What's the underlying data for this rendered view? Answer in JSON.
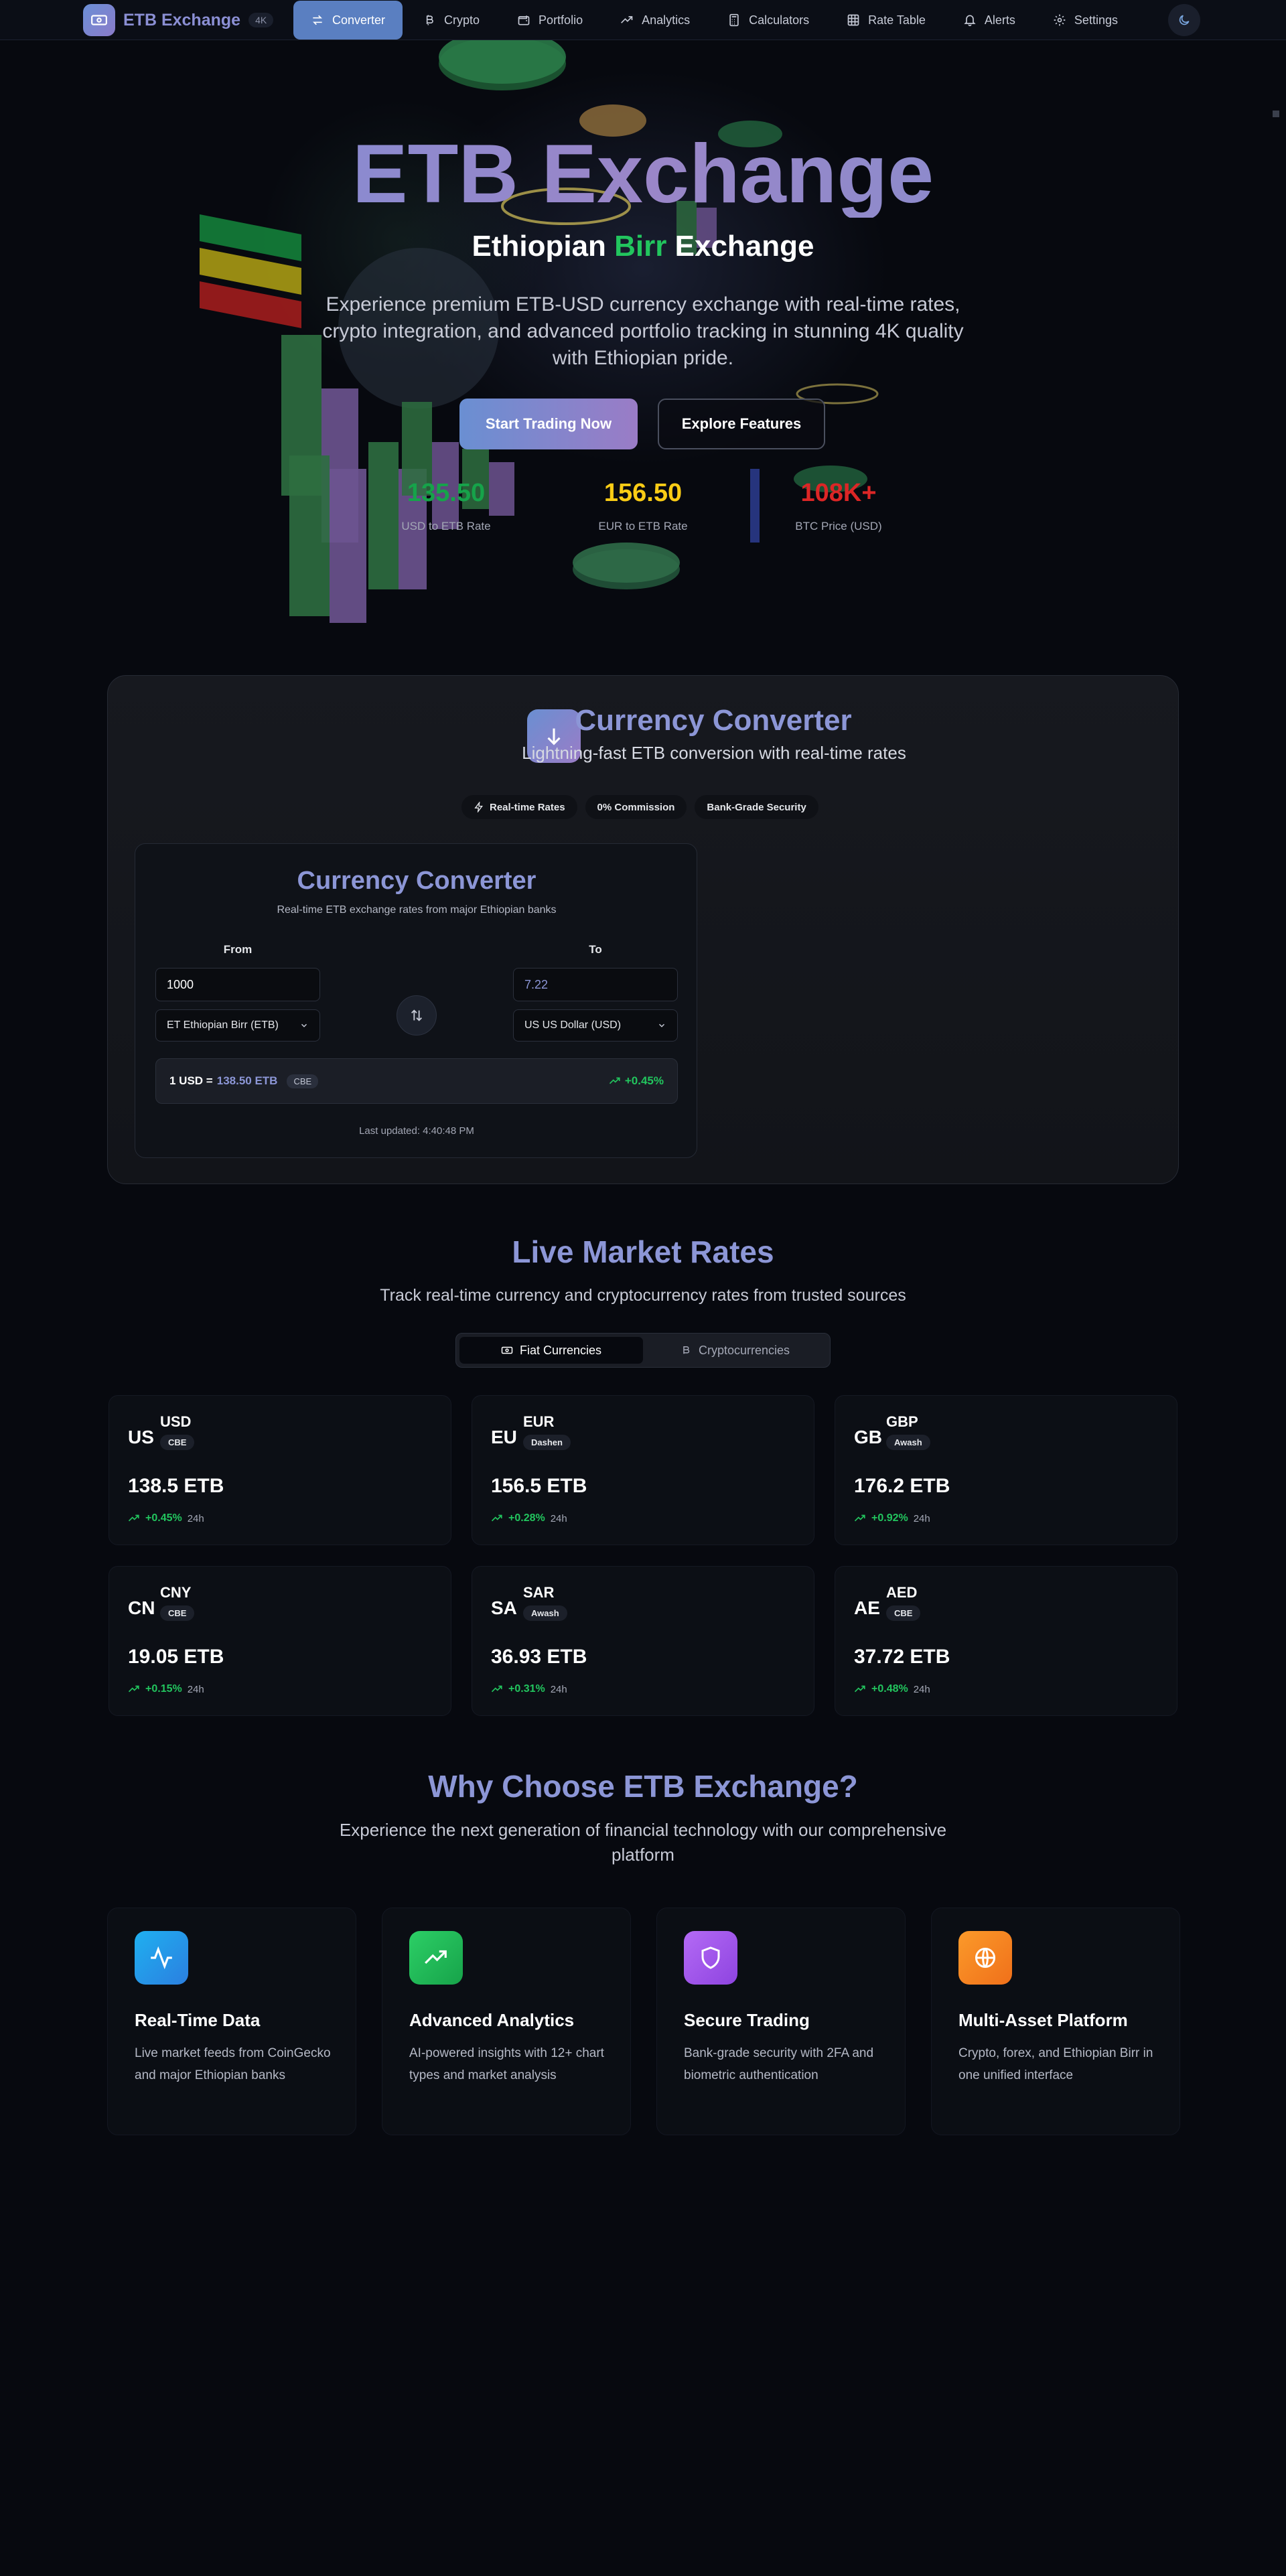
{
  "nav": {
    "brand": "ETB Exchange",
    "badge": "4K",
    "items": [
      {
        "label": "Converter",
        "icon": "arrows-swap-icon",
        "active": true
      },
      {
        "label": "Crypto",
        "icon": "bitcoin-icon",
        "active": false
      },
      {
        "label": "Portfolio",
        "icon": "wallet-icon",
        "active": false
      },
      {
        "label": "Analytics",
        "icon": "trend-up-icon",
        "active": false
      },
      {
        "label": "Calculators",
        "icon": "calculator-icon",
        "active": false
      },
      {
        "label": "Rate Table",
        "icon": "table-icon",
        "active": false
      },
      {
        "label": "Alerts",
        "icon": "bell-icon",
        "active": false
      },
      {
        "label": "Settings",
        "icon": "gear-icon",
        "active": false
      }
    ]
  },
  "hero": {
    "title": "ETB Exchange",
    "subtitle_pre": "Ethiopian ",
    "subtitle_birr": "Birr",
    "subtitle_post": " Exchange",
    "description": "Experience premium ETB-USD currency exchange with real-time rates, crypto integration, and advanced portfolio tracking in stunning 4K quality with Ethiopian pride.",
    "primary_button": "Start Trading Now",
    "secondary_button": "Explore Features",
    "stats": [
      {
        "value": "135.50",
        "label": "USD to ETB Rate",
        "color": "#16a34a"
      },
      {
        "value": "156.50",
        "label": "EUR to ETB Rate",
        "color": "#facc15"
      },
      {
        "value": "108K+",
        "label": "BTC Price (USD)",
        "color": "#dc2626"
      }
    ]
  },
  "converter_section": {
    "title": "Currency Converter",
    "subtitle": "Lightning-fast ETB conversion with real-time rates",
    "chips": [
      "Real-time Rates",
      "0% Commission",
      "Bank-Grade Security"
    ],
    "widget": {
      "title": "Currency Converter",
      "subtitle": "Real-time ETB exchange rates from major Ethiopian banks",
      "from_label": "From",
      "to_label": "To",
      "from_value": "1000",
      "to_value": "7.22",
      "from_currency": "ET Ethiopian Birr (ETB)",
      "to_currency": "US US Dollar (USD)",
      "rate_prefix": "1 USD =",
      "rate_value": "138.50 ETB",
      "rate_bank": "CBE",
      "rate_change": "+0.45%",
      "last_updated": "Last updated: 4:40:48 PM"
    }
  },
  "market": {
    "title": "Live Market Rates",
    "subtitle": "Track real-time currency and cryptocurrency rates from trusted sources",
    "tabs": [
      "Fiat Currencies",
      "Cryptocurrencies"
    ],
    "period": "24h",
    "cards": [
      {
        "country": "US",
        "currency": "USD",
        "bank": "CBE",
        "value": "138.5 ETB",
        "change": "+0.45%"
      },
      {
        "country": "EU",
        "currency": "EUR",
        "bank": "Dashen",
        "value": "156.5 ETB",
        "change": "+0.28%"
      },
      {
        "country": "GB",
        "currency": "GBP",
        "bank": "Awash",
        "value": "176.2 ETB",
        "change": "+0.92%"
      },
      {
        "country": "CN",
        "currency": "CNY",
        "bank": "CBE",
        "value": "19.05 ETB",
        "change": "+0.15%"
      },
      {
        "country": "SA",
        "currency": "SAR",
        "bank": "Awash",
        "value": "36.93 ETB",
        "change": "+0.31%"
      },
      {
        "country": "AE",
        "currency": "AED",
        "bank": "CBE",
        "value": "37.72 ETB",
        "change": "+0.48%"
      }
    ]
  },
  "why": {
    "title": "Why Choose ETB Exchange?",
    "subtitle": "Experience the next generation of financial technology with our comprehensive platform",
    "features": [
      {
        "title": "Real-Time Data",
        "desc": "Live market feeds from CoinGecko and major Ethiopian banks",
        "icon": "activity-icon",
        "color": "#1f9bf0"
      },
      {
        "title": "Advanced Analytics",
        "desc": "AI-powered insights with 12+ chart types and market analysis",
        "icon": "trend-up-icon",
        "color": "#22c55e"
      },
      {
        "title": "Secure Trading",
        "desc": "Bank-grade security with 2FA and biometric authentication",
        "icon": "shield-icon",
        "color": "#a855f7"
      },
      {
        "title": "Multi-Asset Platform",
        "desc": "Crypto, forex, and Ethiopian Birr in one unified interface",
        "icon": "globe-icon",
        "color": "#f97316"
      }
    ]
  }
}
